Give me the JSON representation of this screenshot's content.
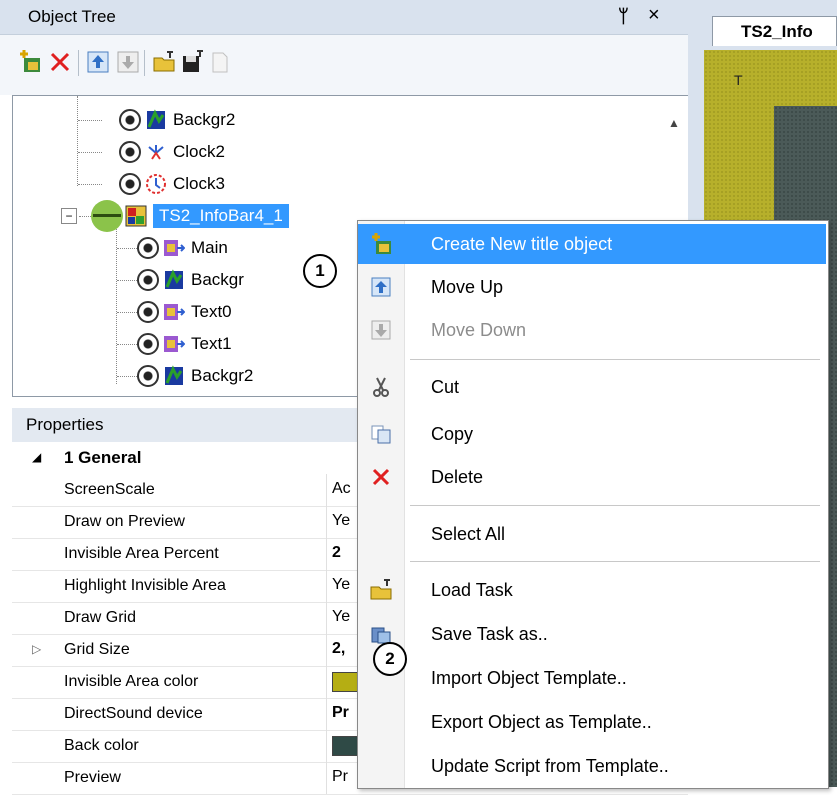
{
  "object_tree": {
    "title": "Object Tree",
    "pin_glyph": "ᛘ",
    "close_glyph": "×",
    "toolbar_icons": [
      "create-object-icon",
      "delete-icon",
      "move-up-icon",
      "move-down-icon",
      "load-task-icon",
      "save-task-icon",
      "new-document-icon"
    ],
    "items": [
      {
        "label": "Backgr2",
        "icon": "background-object-icon"
      },
      {
        "label": "Clock2",
        "icon": "clock-object-icon"
      },
      {
        "label": "Clock3",
        "icon": "clock-object-icon"
      },
      {
        "label": "TS2_InfoBar4_1",
        "icon": "infobar-object-icon",
        "selected": true
      },
      {
        "label": "Main",
        "icon": "text-object-icon"
      },
      {
        "label": "Backgr",
        "icon": "background-object-icon"
      },
      {
        "label": "Text0",
        "icon": "text-object-icon"
      },
      {
        "label": "Text1",
        "icon": "text-object-icon"
      },
      {
        "label": "Backgr2",
        "icon": "background-object-icon"
      }
    ],
    "expand_glyph": "−"
  },
  "callouts": {
    "one": "1",
    "two": "2"
  },
  "properties": {
    "title": "Properties",
    "group": "1 General",
    "rows": [
      {
        "name": "ScreenScale",
        "value": "Ac",
        "expand": ""
      },
      {
        "name": "Draw on Preview",
        "value": "Ye",
        "expand": ""
      },
      {
        "name": "Invisible Area Percent",
        "value": "2",
        "expand": "",
        "bold": true
      },
      {
        "name": "Highlight Invisible Area",
        "value": "Ye",
        "expand": ""
      },
      {
        "name": "Draw Grid",
        "value": "Ye",
        "expand": ""
      },
      {
        "name": "Grid Size",
        "value": "2,",
        "expand": "▷",
        "bold": true
      },
      {
        "name": "Invisible Area color",
        "value": "",
        "expand": "",
        "swatch": "#b5ae13"
      },
      {
        "name": "DirectSound device",
        "value": "Pr",
        "expand": "",
        "bold": true
      },
      {
        "name": "Back color",
        "value": "",
        "expand": "",
        "swatch": "#2f4a46"
      },
      {
        "name": "Preview",
        "value": "Pr",
        "expand": ""
      }
    ]
  },
  "document_tab": {
    "label": "TS2_Info"
  },
  "canvas": {
    "marker": "T"
  },
  "context_menu": {
    "items": [
      {
        "label": "Create New title object",
        "icon": "create-object-icon",
        "state": "highlight"
      },
      {
        "label": "Move Up",
        "icon": "move-up-icon",
        "state": "normal"
      },
      {
        "label": "Move Down",
        "icon": "move-down-icon",
        "state": "disabled"
      },
      {
        "label": "Cut",
        "icon": "scissors-icon",
        "state": "normal"
      },
      {
        "label": "Copy",
        "icon": "copy-icon",
        "state": "normal"
      },
      {
        "label": "Delete",
        "icon": "delete-icon",
        "state": "normal"
      },
      {
        "label": "Select All",
        "icon": "",
        "state": "normal"
      },
      {
        "label": "Load Task",
        "icon": "load-task-icon",
        "state": "normal"
      },
      {
        "label": "Save Task as..",
        "icon": "save-task-icon",
        "state": "normal"
      },
      {
        "label": "Import Object Template..",
        "icon": "",
        "state": "normal"
      },
      {
        "label": "Export Object as Template..",
        "icon": "",
        "state": "normal"
      },
      {
        "label": "Update Script from Template..",
        "icon": "",
        "state": "normal"
      }
    ]
  },
  "colors": {
    "highlight": "#3399ff",
    "panel": "#d9e2ee",
    "canvas_yellow": "#b7b02b",
    "canvas_dark": "#4b5a58"
  }
}
